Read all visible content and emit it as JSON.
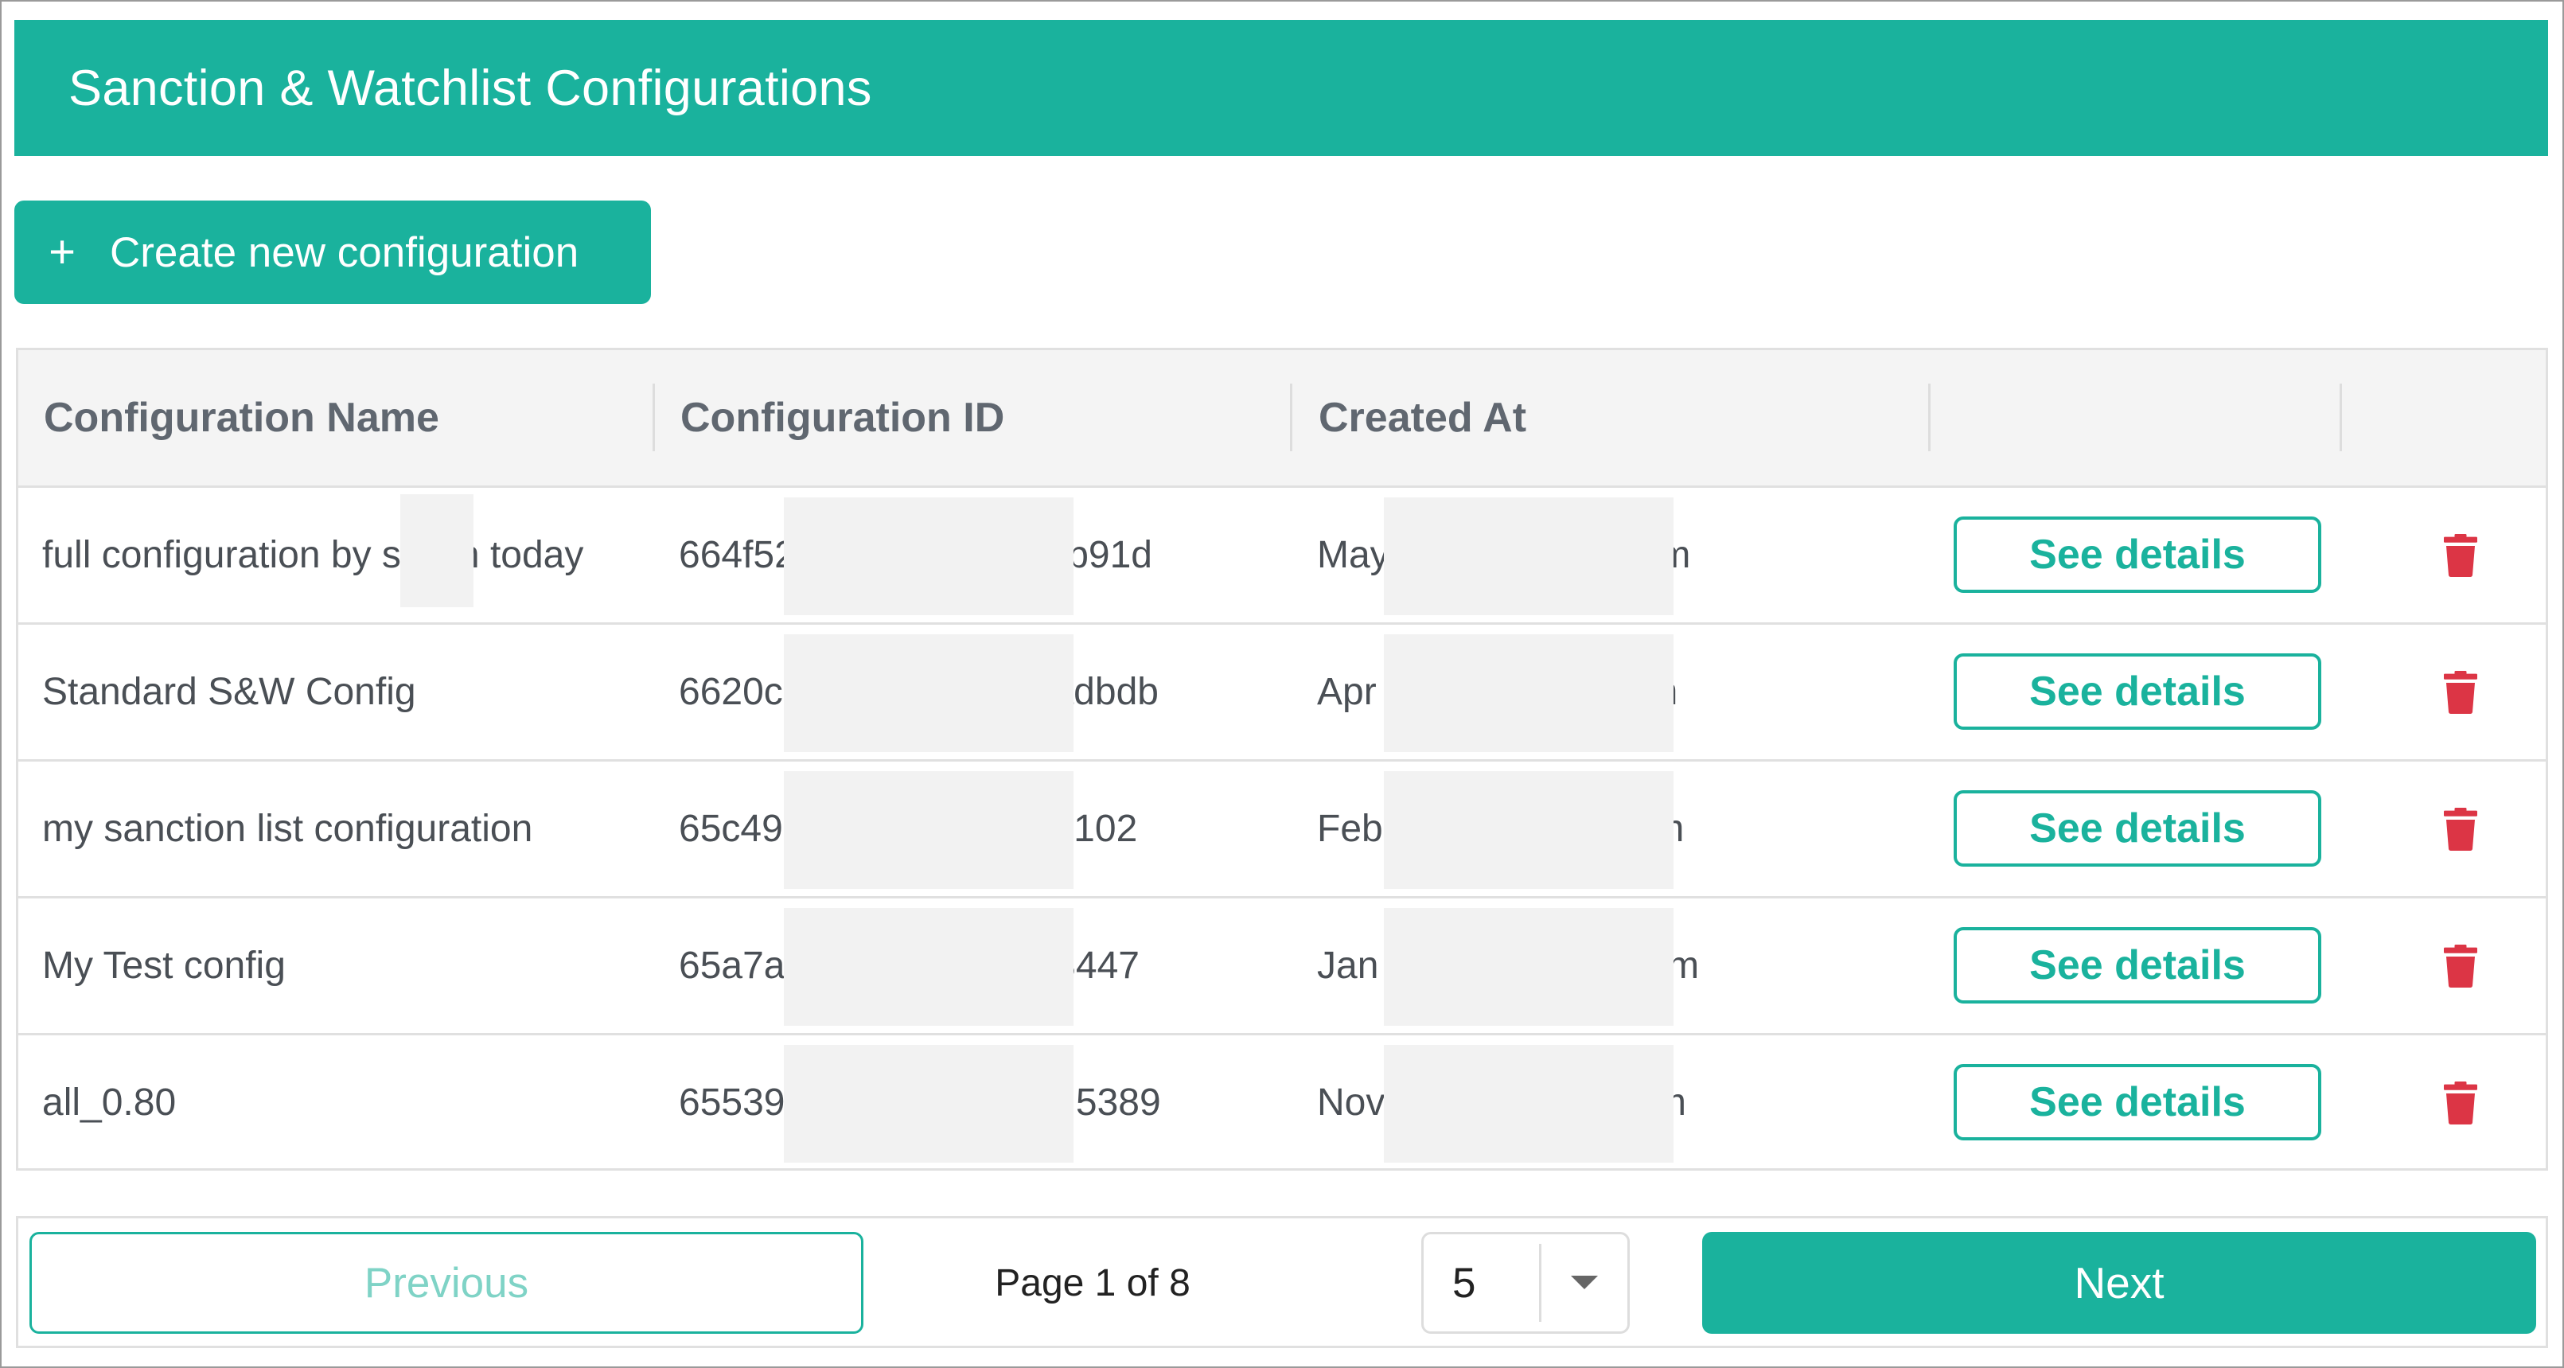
{
  "header": {
    "title": "Sanction & Watchlist Configurations"
  },
  "toolbar": {
    "create_icon": "+",
    "create_label": "Create new configuration"
  },
  "table": {
    "columns": [
      "Configuration Name",
      "Configuration ID",
      "Created At",
      "",
      ""
    ],
    "rows": [
      {
        "name": "full configuration by s   n today",
        "id": "664f52            02b91d",
        "created": "May             pm",
        "details_label": "See details",
        "delete_icon": "trash-icon"
      },
      {
        "name": "Standard S&W Config",
        "id": "6620c             aadbdb",
        "created": "Apr             am",
        "details_label": "See details",
        "delete_icon": "trash-icon"
      },
      {
        "name": "my sanction list configuration",
        "id": "65c49             2d102",
        "created": "Feb             am",
        "details_label": "See details",
        "delete_icon": "trash-icon"
      },
      {
        "name": "My Test config",
        "id": "65a7a             d3447",
        "created": "Jan              am",
        "details_label": "See details",
        "delete_icon": "trash-icon"
      },
      {
        "name": "all_0.80",
        "id": "65539             3d5389",
        "created": "Nov             pm",
        "details_label": "See details",
        "delete_icon": "trash-icon"
      }
    ]
  },
  "pagination": {
    "previous_label": "Previous",
    "page_info": "Page 1 of 8",
    "page_size": "5",
    "next_label": "Next"
  },
  "colors": {
    "accent": "#1ab29d",
    "danger": "#dc3545",
    "disabled_text": "#7fd3c6"
  }
}
